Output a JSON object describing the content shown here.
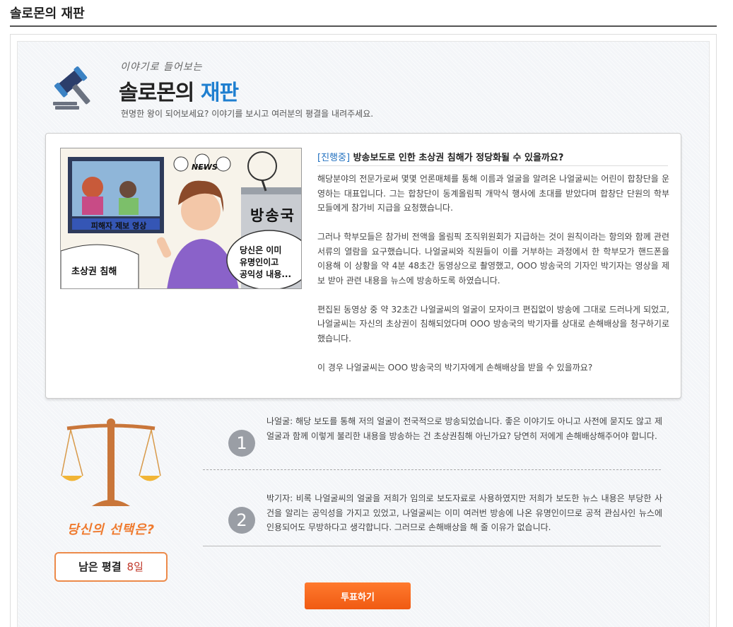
{
  "page": {
    "title": "솔로몬의 재판"
  },
  "header": {
    "script_subtitle": "이야기로 들어보는",
    "title_main": "솔로몬의",
    "title_accent": "재판",
    "description": "현명한 왕이 되어보세요? 이야기를 보시고 여러분의 평결을 내려주세요."
  },
  "cartoon": {
    "news_label": "NEWS",
    "victim_caption": "피해자 제보 영상",
    "left_caption": "초상권 침해",
    "station_sign": "방송국",
    "speech_line1": "당신은 이미",
    "speech_line2": "유명인이고",
    "speech_line3": "공익성 내용..."
  },
  "article": {
    "status_tag": "[진행중]",
    "title": "방송보도로 인한 초상권 침해가 정당화될 수 있을까요?",
    "paragraphs": [
      "해당분야의 전문가로써 몇몇 언론매체를 통해 이름과 얼굴을 알려온 나얼굴씨는 어린이 합창단을 운영하는 대표입니다. 그는 합창단이 동계올림픽 개막식 행사에 초대를 받았다며 합창단 단원의 학부모들에게 참가비 지급을 요청했습니다.",
      "그러나 학부모들은 참가비 전액을 올림픽 조직위원회가 지급하는 것이 원칙이라는 항의와 함께 관련 서류의 열람을 요구했습니다. 나얼굴씨와 직원들이 이를 거부하는 과정에서 한 학부모가 핸드폰을 이용해 이 상황을 약 4분 48초간 동영상으로 촬영했고, OOO 방송국의 기자인 박기자는 영상을 제보 받아 관련 내용을 뉴스에 방송하도록 하였습니다.",
      "편집된 동영상 중 약 32초간 나얼굴씨의 얼굴이 모자이크 편집없이 방송에 그대로 드러나게 되었고, 나얼굴씨는 자신의 초상권이 침해되었다며 OOO 방송국의 박기자를 상대로 손해배상을 청구하기로 했습니다.",
      "이 경우 나얼굴씨는 OOO 방송국의 박기자에게 손해배상을 받을 수 있을까요?"
    ]
  },
  "voting": {
    "choice_prompt": "당신의 선택은?",
    "remaining_label": "남은 평결",
    "remaining_days": "8일",
    "options": [
      {
        "number": "1",
        "text": "나얼굴: 해당 보도를 통해 저의 얼굴이 전국적으로 방송되었습니다. 좋은 이야기도 아니고 사전에 묻지도 않고 제 얼굴과 함께 이렇게 불리한 내용을 방송하는 건 초상권침해 아닌가요? 당연히 저에게 손해배상해주어야 합니다."
      },
      {
        "number": "2",
        "text": "박기자: 비록 나얼굴씨의 얼굴을 저희가 임의로 보도자료로 사용하였지만 저희가 보도한 뉴스 내용은 부당한 사건을 알리는 공익성을 가지고 있었고, 나얼굴씨는 이미 여러번 방송에 나온 유명인이므로 공적 관심사인 뉴스에 인용되어도 무방하다고 생각합니다. 그러므로 손해배상을 해 줄 이유가 없습니다."
      }
    ],
    "vote_button": "투표하기"
  },
  "colors": {
    "accent_blue": "#1f7fd0",
    "vote_orange": "#f05a12",
    "choice_orange": "#ef7a2e",
    "status_blue": "#1f6fbf"
  },
  "icons": [
    "gavel-icon",
    "scale-icon"
  ]
}
